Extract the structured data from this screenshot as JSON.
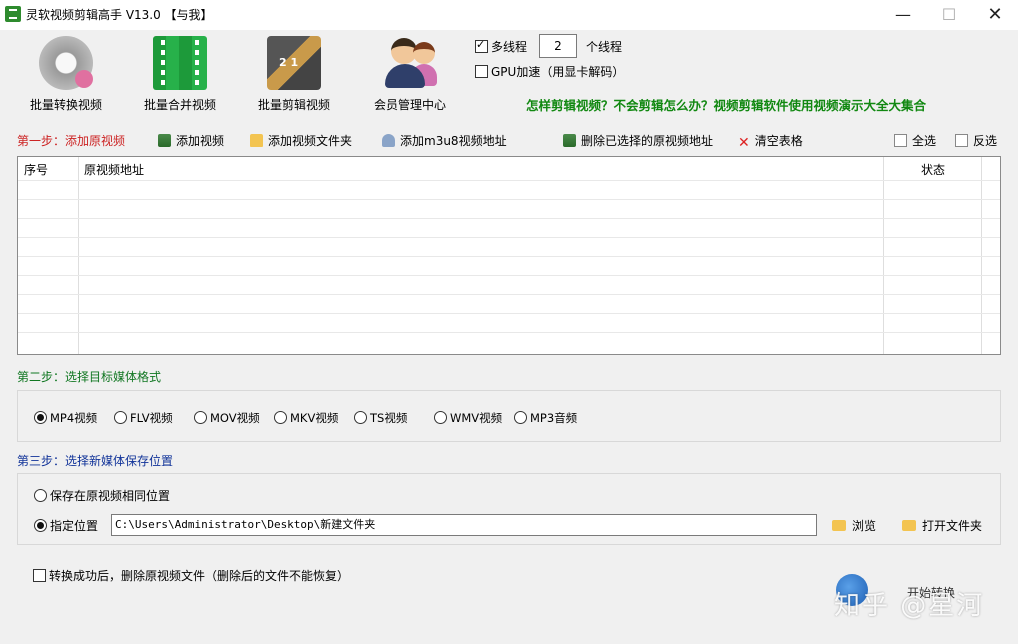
{
  "window": {
    "title": "灵软视频剪辑高手 V13.0 【与我】",
    "minimize": "—",
    "maximize": "☐",
    "close": "✕"
  },
  "toolbar": {
    "batch_convert": "批量转换视频",
    "batch_merge": "批量合并视频",
    "batch_edit": "批量剪辑视频",
    "member_center": "会员管理中心"
  },
  "options": {
    "multithread_label": "多线程",
    "multithread_checked": true,
    "thread_count": "2",
    "thread_unit": "个线程",
    "gpu_label": "GPU加速（用显卡解码）",
    "gpu_checked": false
  },
  "promo_link": "怎样剪辑视频？不会剪辑怎么办？视频剪辑软件使用视频演示大全大集合",
  "step1": {
    "title": "第一步：添加原视频",
    "add_video": "添加视频",
    "add_folder": "添加视频文件夹",
    "add_m3u8": "添加m3u8视频地址",
    "delete_selected": "删除已选择的原视频地址",
    "clear_table": "清空表格",
    "select_all": "全选",
    "invert_select": "反选"
  },
  "table": {
    "columns": [
      "序号",
      "原视频地址",
      "状态"
    ],
    "rows": []
  },
  "step2": {
    "title": "第二步：选择目标媒体格式",
    "formats": [
      "MP4视频",
      "FLV视频",
      "MOV视频",
      "MKV视频",
      "TS视频",
      "WMV视频",
      "MP3音频"
    ],
    "selected": "MP4视频"
  },
  "step3": {
    "title": "第三步：选择新媒体保存位置",
    "same_location": "保存在原视频相同位置",
    "specified_location": "指定位置",
    "path": "C:\\Users\\Administrator\\Desktop\\新建文件夹",
    "browse": "浏览",
    "open_folder": "打开文件夹"
  },
  "delete_source_option": "转换成功后，删除原视频文件（删除后的文件不能恢复）",
  "start_label": "开始转换",
  "watermark": "知乎 @星河",
  "icons": {
    "app": "app-logo-icon",
    "add_video": "film-add-icon",
    "add_folder": "folder-add-icon",
    "add_m3u8": "network-icon",
    "delete": "film-delete-icon",
    "clear": "red-x-icon",
    "select_all": "document-icon",
    "browse": "folder-icon",
    "start": "refresh-icon"
  },
  "colors": {
    "step1": "#cc2222",
    "step2": "#117722",
    "step3": "#113399",
    "promo": "#118811"
  }
}
